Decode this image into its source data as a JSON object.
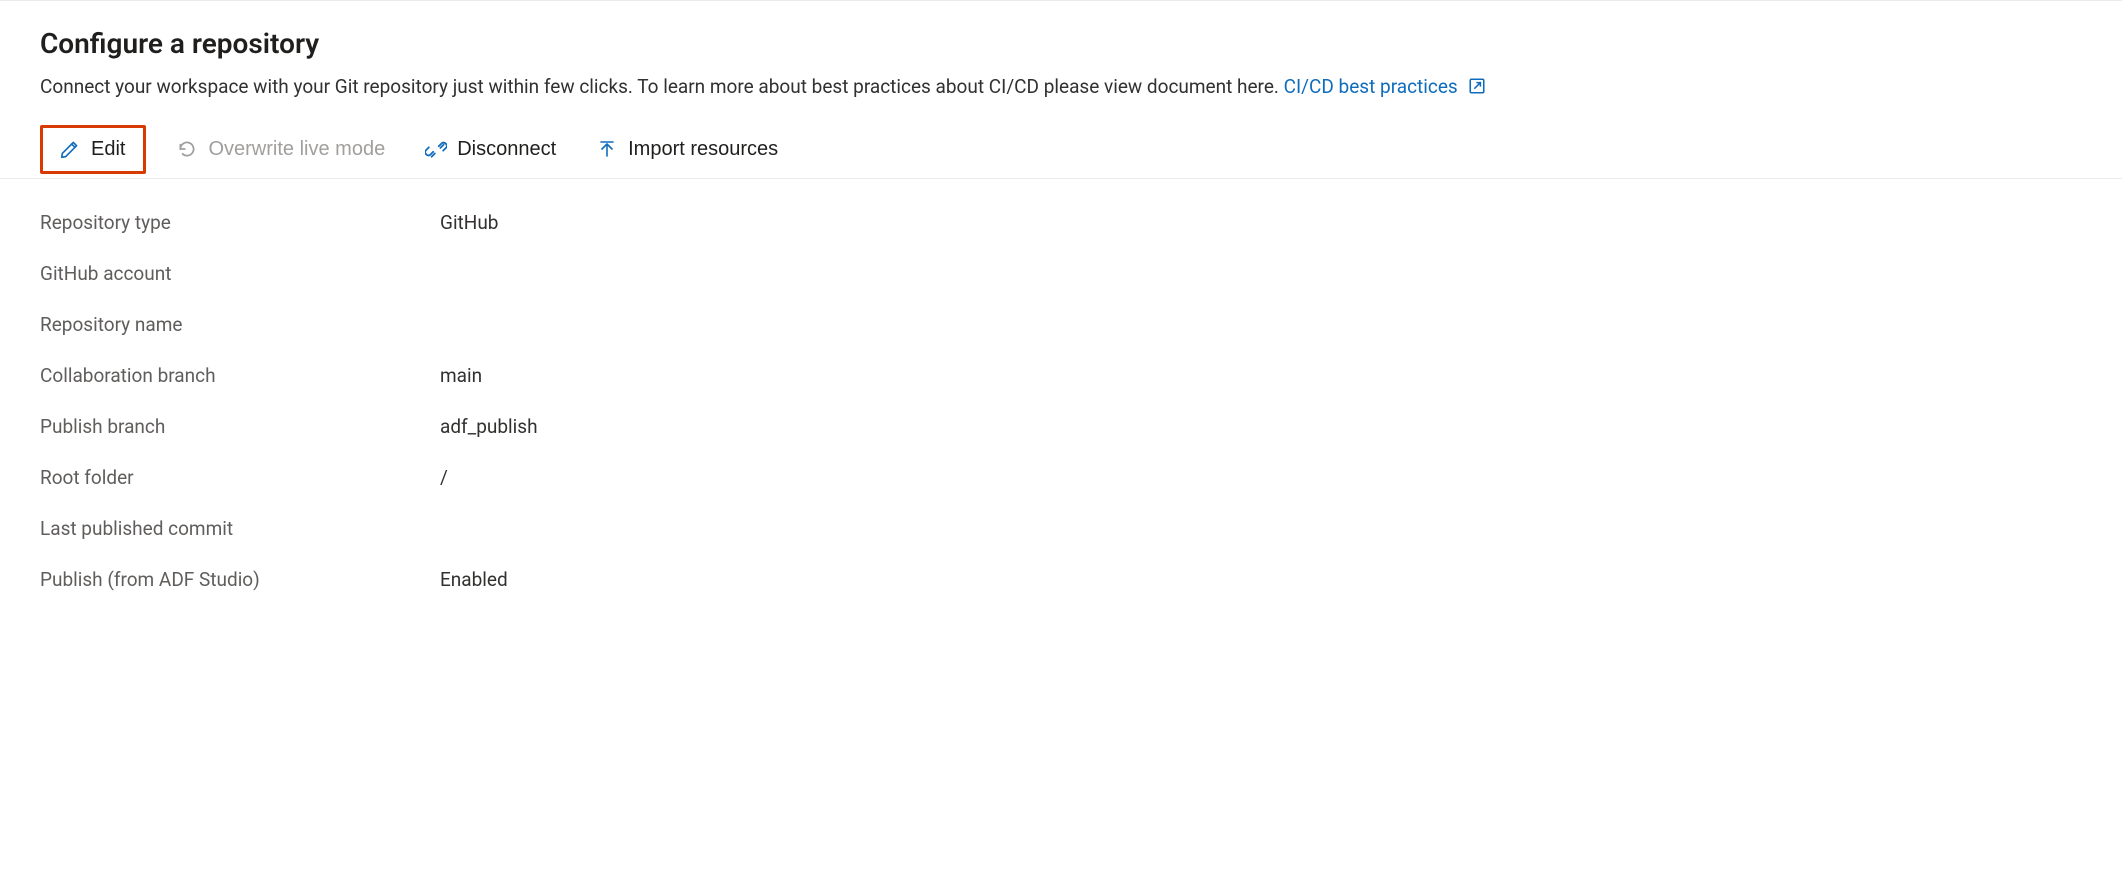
{
  "header": {
    "title": "Configure a repository",
    "description_prefix": "Connect your workspace with your Git repository just within few clicks. To learn more about best practices about CI/CD please view document here.  ",
    "link_label": "CI/CD best practices"
  },
  "toolbar": {
    "edit_label": "Edit",
    "overwrite_label": "Overwrite live mode",
    "disconnect_label": "Disconnect",
    "import_label": "Import resources"
  },
  "details": {
    "rows": [
      {
        "label": "Repository type",
        "value": "GitHub"
      },
      {
        "label": "GitHub account",
        "value": ""
      },
      {
        "label": "Repository name",
        "value": ""
      },
      {
        "label": "Collaboration branch",
        "value": "main"
      },
      {
        "label": "Publish branch",
        "value": "adf_publish"
      },
      {
        "label": "Root folder",
        "value": "/"
      },
      {
        "label": "Last published commit",
        "value": ""
      },
      {
        "label": "Publish (from ADF Studio)",
        "value": "Enabled"
      }
    ]
  },
  "colors": {
    "link": "#0f6cbd",
    "highlight_border": "#d83b01",
    "disabled": "#a19f9d"
  }
}
